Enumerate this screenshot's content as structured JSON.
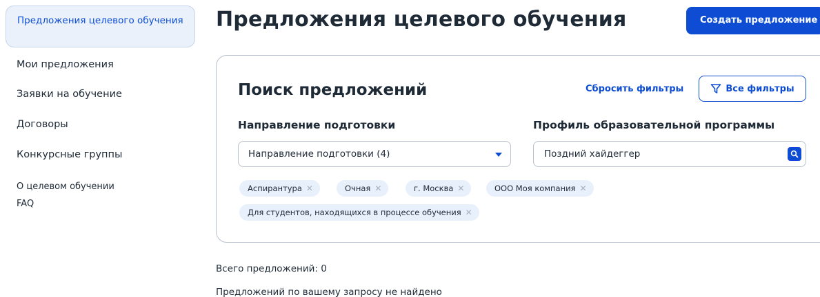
{
  "sidebar": {
    "active_item": "Предложения целевого обучения",
    "items": [
      "Мои предложения",
      "Заявки на обучение",
      "Договоры",
      "Конкурсные группы",
      "О целевом обучении",
      "FAQ"
    ]
  },
  "header": {
    "title": "Предложения целевого обучения",
    "create_button": "Создать предложение"
  },
  "search": {
    "title": "Поиск предложений",
    "reset_link": "Сбросить фильтры",
    "all_filters_button": "Все фильтры",
    "direction": {
      "label": "Направление подготовки",
      "value": "Направление подготовки (4)"
    },
    "profile": {
      "label": "Профиль образовательной программы",
      "value": "Поздний хайдеггер"
    },
    "chips": [
      "Аспирантура",
      "Очная",
      "г. Москва",
      "ООО Моя компания",
      "Для студентов, находящихся в процессе обучения"
    ]
  },
  "results": {
    "total": "Всего предложений: 0",
    "empty": "Предложений по вашему запросу не найдено"
  },
  "colors": {
    "accent": "#0d4cd3",
    "active_nav_bg": "#eaf1fb",
    "chip_bg": "#e8f0fb"
  }
}
